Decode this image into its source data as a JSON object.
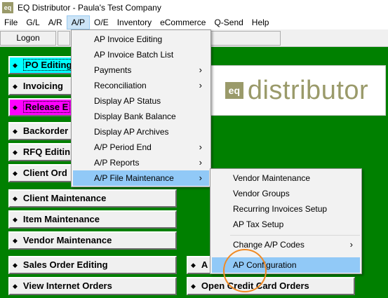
{
  "window": {
    "title": "EQ Distributor - Paula's Test Company",
    "icon_text": "eq"
  },
  "menubar": {
    "items": [
      "File",
      "G/L",
      "A/R",
      "A/P",
      "O/E",
      "Inventory",
      "eCommerce",
      "Q-Send",
      "Help"
    ]
  },
  "toolbar": {
    "logon_label": "Logon"
  },
  "logo": {
    "box_text": "eq",
    "text": "distributor"
  },
  "main_buttons": {
    "po_editing": "PO Editing",
    "invoicing": "Invoicing",
    "release": "Release E",
    "backorders": "Backorder",
    "rfq_editing": "RFQ Editin",
    "client_orders": "Client Ord",
    "client_maintenance": "Client Maintenance",
    "item_maintenance": "Item Maintenance",
    "vendor_maintenance": "Vendor Maintenance",
    "sales_order_editing": "Sales Order Editing",
    "view_internet_orders": "View Internet Orders",
    "right_a": "A",
    "open_credit_card_orders": "Open Credit Card Orders"
  },
  "ap_menu": {
    "items": [
      {
        "label": "AP Invoice Editing"
      },
      {
        "label": "AP Invoice Batch List"
      },
      {
        "label": "Payments"
      },
      {
        "label": "Reconciliation"
      },
      {
        "label": "Display AP Status"
      },
      {
        "label": "Display Bank Balance"
      },
      {
        "label": "Display AP Archives"
      },
      {
        "label": "A/P Period End"
      },
      {
        "label": "A/P Reports"
      },
      {
        "label": "A/P File Maintenance"
      }
    ]
  },
  "file_maintenance_menu": {
    "items": [
      {
        "label": "Vendor Maintenance"
      },
      {
        "label": "Vendor Groups"
      },
      {
        "label": "Recurring Invoices Setup"
      },
      {
        "label": "AP Tax Setup"
      },
      {
        "label": "Change A/P Codes"
      },
      {
        "label": "AP Configuration"
      }
    ]
  },
  "glyphs": {
    "arrow": "›",
    "diamond": "◆"
  }
}
